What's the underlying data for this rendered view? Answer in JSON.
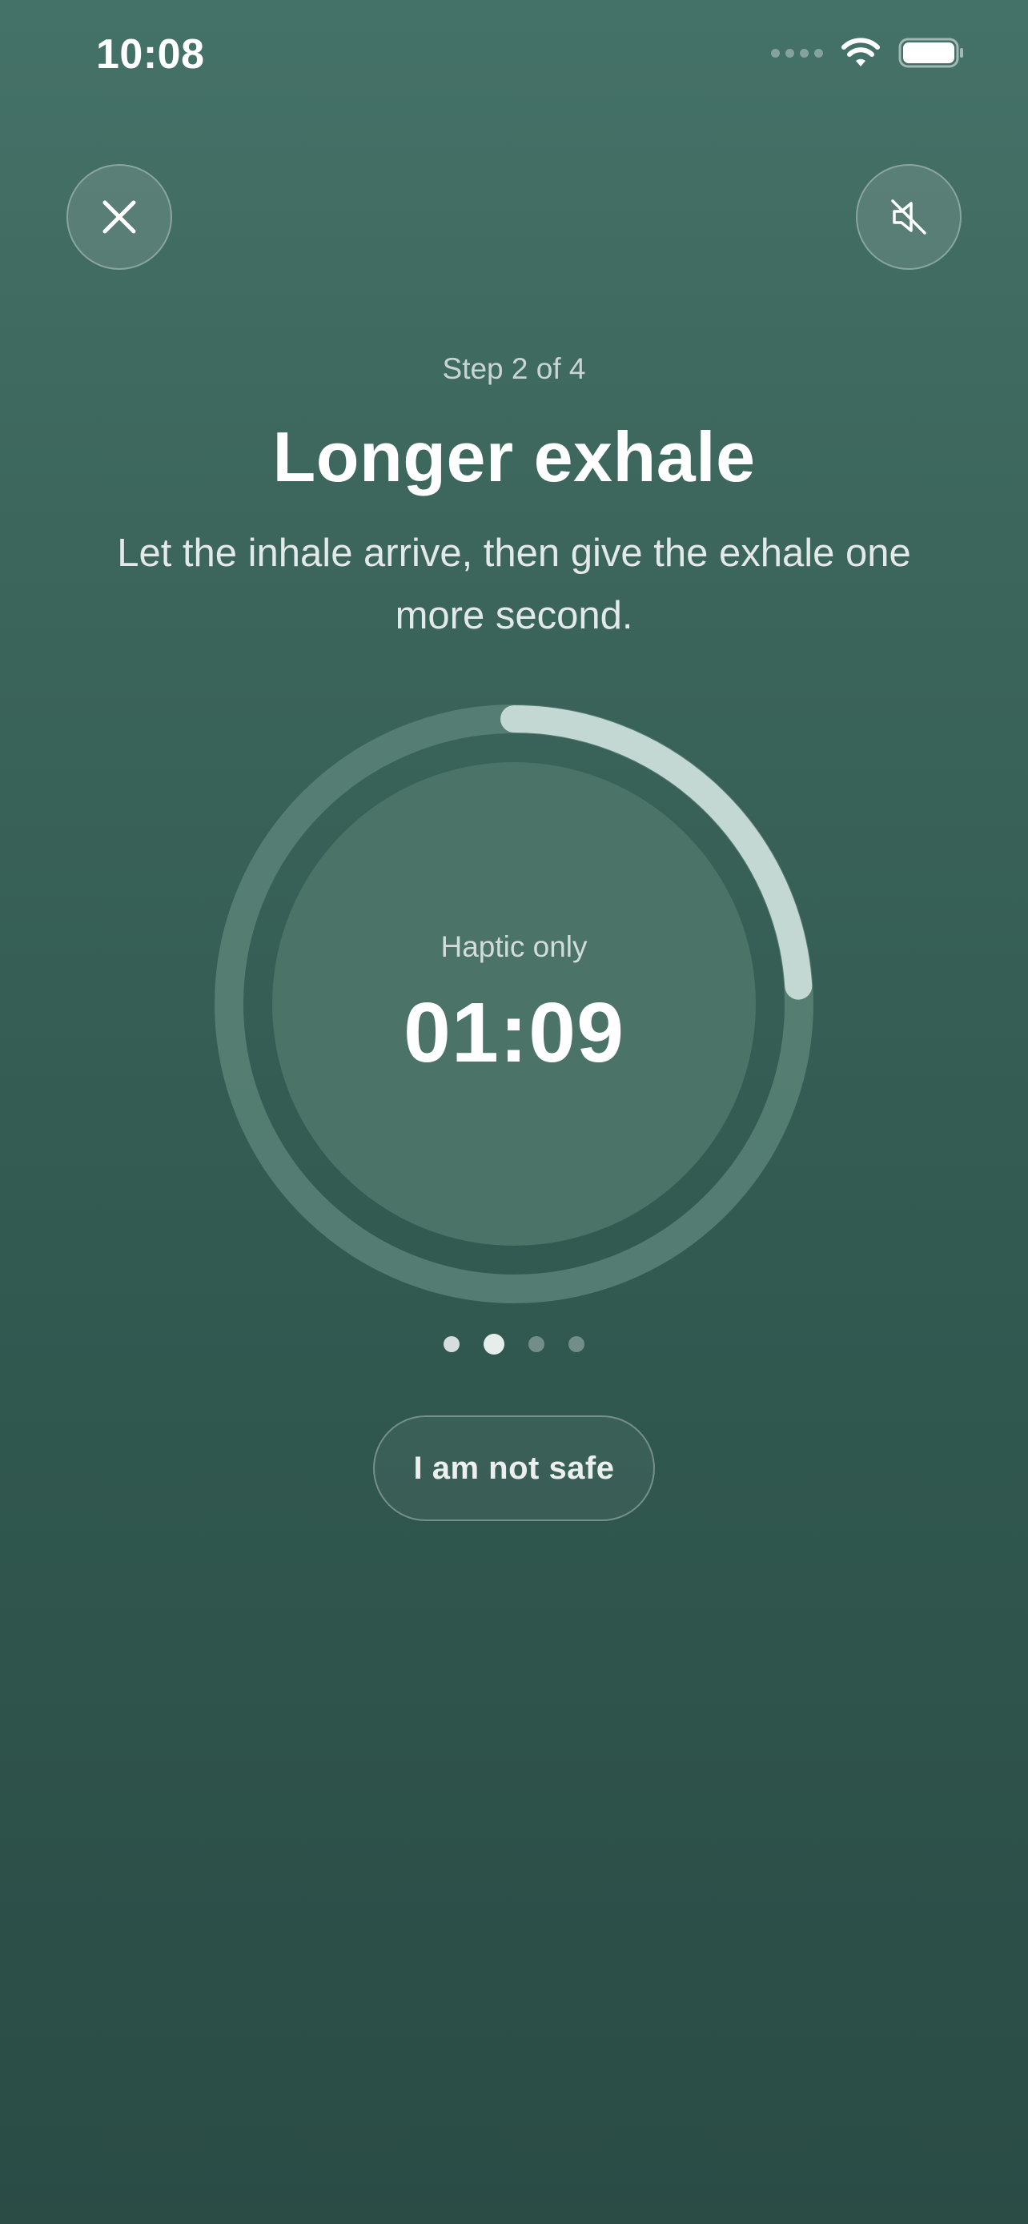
{
  "status_bar": {
    "time": "10:08",
    "wifi_icon": "wifi-icon",
    "battery_icon": "battery-icon",
    "signal_icon": "cellular-signal-icon"
  },
  "top_buttons": {
    "close_icon": "close-icon",
    "mute_icon": "speaker-muted-icon"
  },
  "header": {
    "step_label": "Step 2 of 4",
    "title": "Longer exhale",
    "subtitle": "Let the inhale arrive, then give the exhale one more second."
  },
  "dial": {
    "mode_label": "Haptic only",
    "timer": "01:09",
    "progress_fraction": 0.24
  },
  "steps": {
    "total": 4,
    "current": 2
  },
  "actions": {
    "not_safe_label": "I am not safe"
  },
  "colors": {
    "background_top": "#457268",
    "background_bottom": "#2a4c45",
    "progress_arc": "#c3d8d3",
    "ring_track": "#5a8378"
  }
}
